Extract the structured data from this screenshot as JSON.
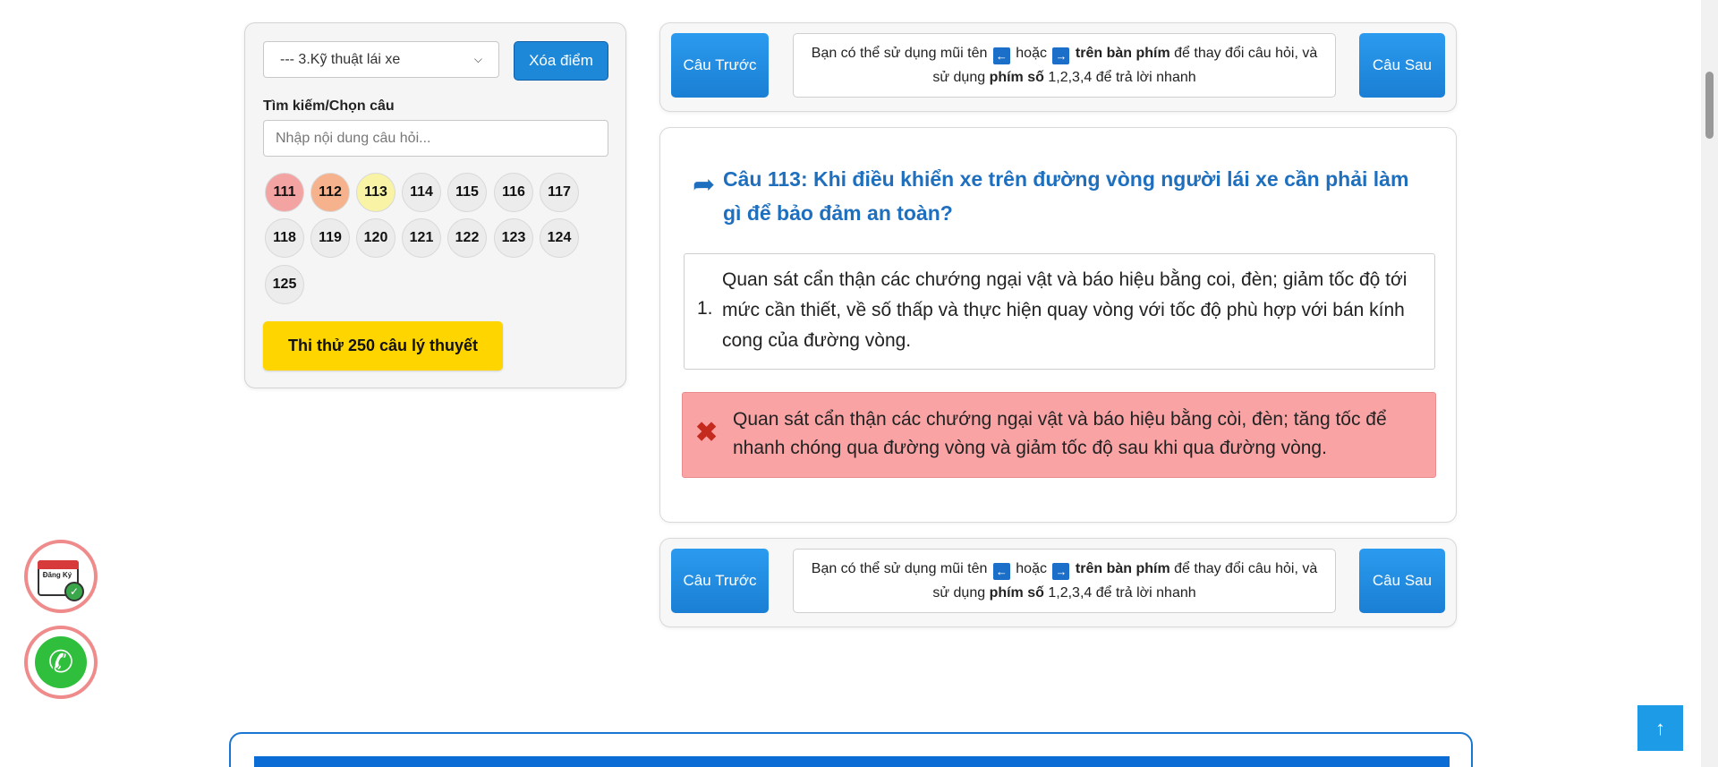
{
  "sidebar": {
    "topic_select": "--- 3.Kỹ thuật lái xe",
    "clear_button": "Xóa điểm",
    "search_label": "Tìm kiếm/Chọn câu",
    "search_placeholder": "Nhập nội dung câu hỏi...",
    "question_numbers": [
      {
        "n": "111",
        "state": "wrong"
      },
      {
        "n": "112",
        "state": "partial"
      },
      {
        "n": "113",
        "state": "current"
      },
      {
        "n": "114",
        "state": "default"
      },
      {
        "n": "115",
        "state": "default"
      },
      {
        "n": "116",
        "state": "default"
      },
      {
        "n": "117",
        "state": "default"
      },
      {
        "n": "118",
        "state": "default"
      },
      {
        "n": "119",
        "state": "default"
      },
      {
        "n": "120",
        "state": "default"
      },
      {
        "n": "121",
        "state": "default"
      },
      {
        "n": "122",
        "state": "default"
      },
      {
        "n": "123",
        "state": "default"
      },
      {
        "n": "124",
        "state": "default"
      },
      {
        "n": "125",
        "state": "default"
      }
    ],
    "trial_button": "Thi thử 250 câu lý thuyết"
  },
  "nav": {
    "prev_label": "Câu Trước",
    "next_label": "Câu Sau",
    "hint": {
      "part1": "Bạn có thể sử dụng mũi tên",
      "left_key": "←",
      "or": "hoặc",
      "right_key": "→",
      "bold1": "trên bàn phím",
      "part2": "để thay đổi câu hỏi, và",
      "part3": "sử dụng",
      "bold2": "phím số",
      "part4": "1,2,3,4 để trả lời nhanh"
    }
  },
  "question": {
    "title": "Câu 113: Khi điều khiển xe trên đường vòng người lái xe cần phải làm gì để bảo đảm an toàn?",
    "answers": [
      {
        "num": "1.",
        "text": "Quan sát cẩn thận các chướng ngại vật và báo hiệu bằng coi, đèn; giảm tốc độ tới mức cần thiết, về số thấp và thực hiện quay vòng với tốc độ phù hợp với bán kính cong của đường vòng."
      }
    ],
    "wrong_answer": "Quan sát cẩn thận các chướng ngại vật và báo hiệu bằng còi, đèn; tăng tốc để nhanh chóng qua đường vòng và giảm tốc độ sau khi qua đường vòng."
  },
  "floating": {
    "register_label": "Đăng Ký",
    "register_icon": "calendar-check-icon",
    "phone_icon": "phone-icon",
    "back_to_top_icon": "arrow-up-icon"
  },
  "colors": {
    "primary_blue": "#1e88d8",
    "title_blue": "#1f6fbf",
    "wrong_bg": "#f9a3a5",
    "trial_yellow": "#ffd500"
  }
}
